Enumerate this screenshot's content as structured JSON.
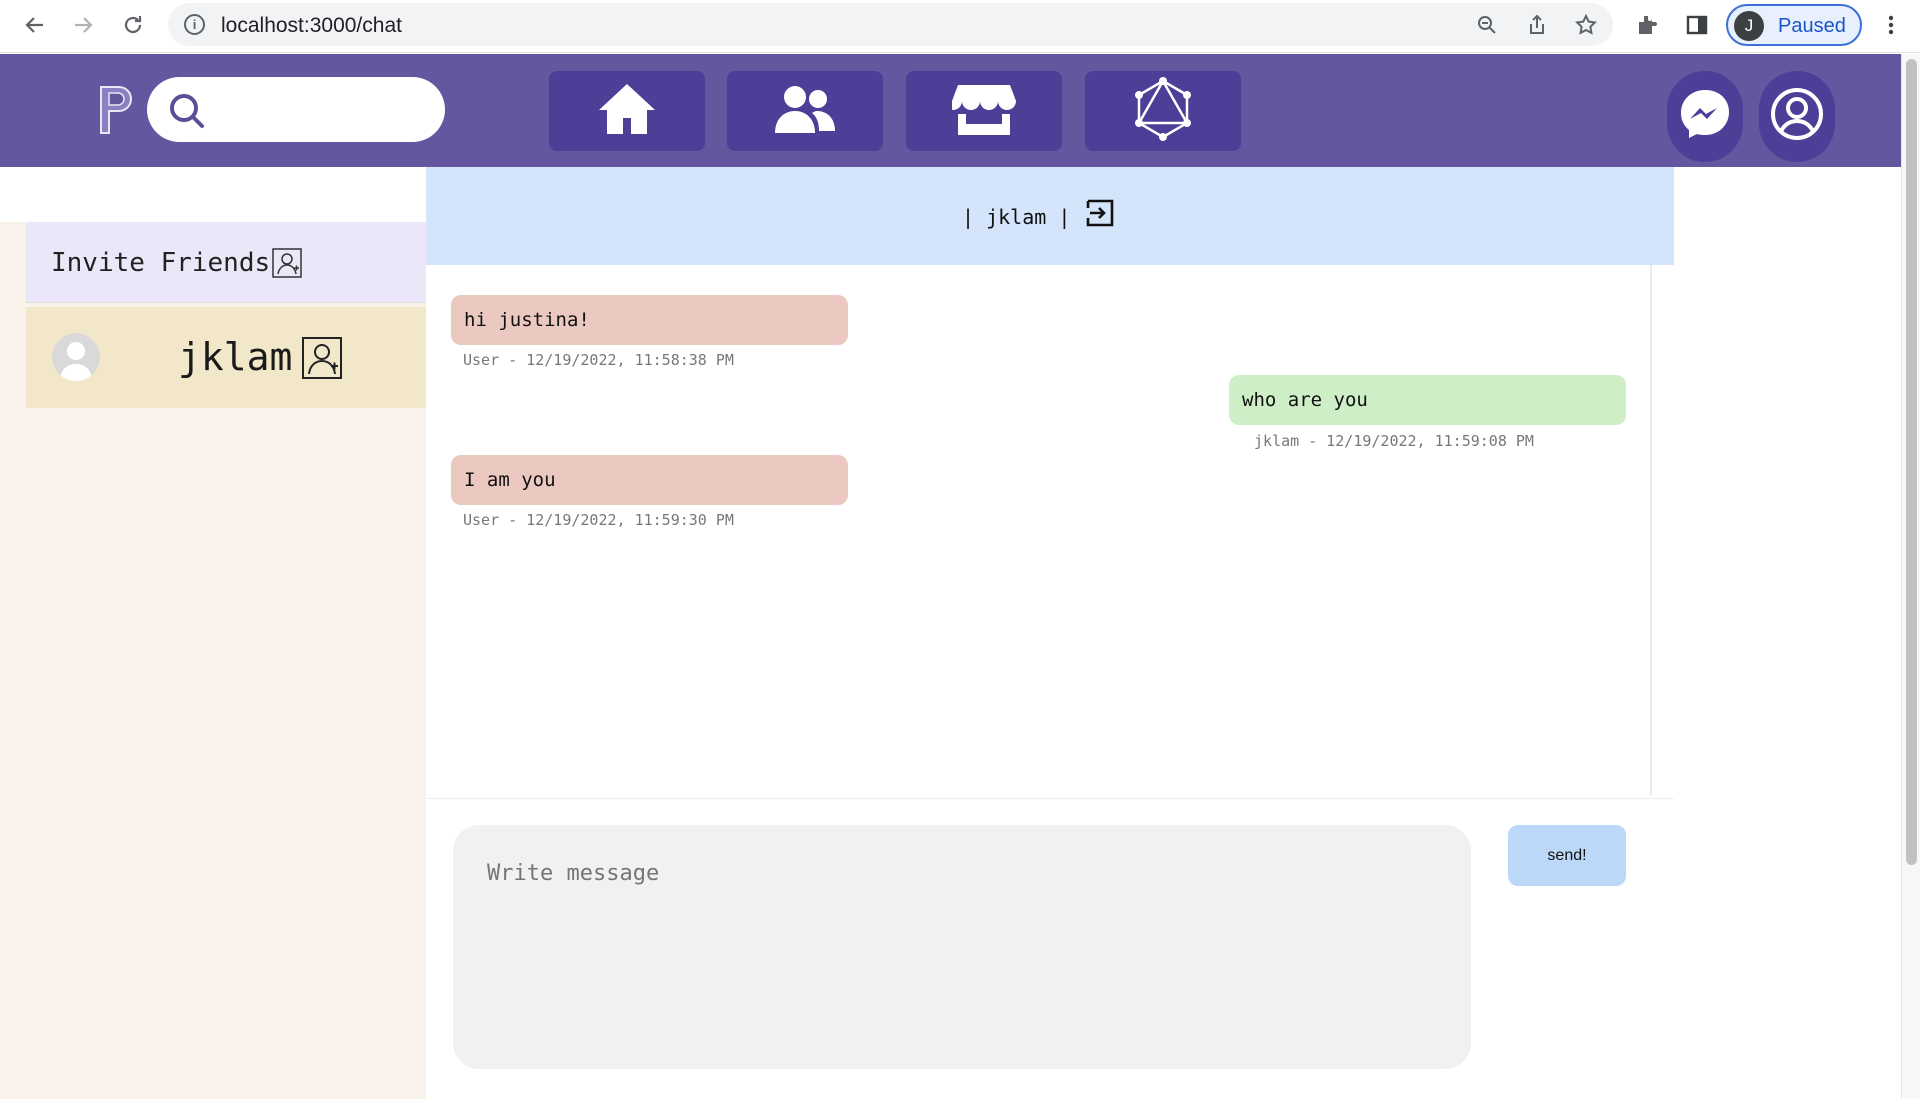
{
  "browser": {
    "url": "localhost:3000/chat",
    "profile_initial": "J",
    "profile_status": "Paused",
    "icons": [
      "back-icon",
      "forward-icon",
      "reload-icon",
      "info-icon",
      "zoom-icon",
      "share-icon",
      "star-icon",
      "extensions-icon",
      "sidebar-icon",
      "more-icon"
    ]
  },
  "header": {
    "search_placeholder": "",
    "nav": [
      "home-icon",
      "friends-icon",
      "store-icon",
      "graphql-icon"
    ],
    "right": [
      "messenger-icon",
      "account-icon"
    ],
    "colors": {
      "bar": "#6556a0",
      "tile": "#4b3f97"
    }
  },
  "sidebar": {
    "invite_label": "Invite Friends",
    "friends": [
      {
        "name": "jklam"
      }
    ]
  },
  "chat": {
    "title": "| jklam |",
    "messages": [
      {
        "side": "left",
        "text": "hi justina!",
        "meta": "User - 12/19/2022, 11:58:38 PM"
      },
      {
        "side": "right",
        "text": "who are you",
        "meta": "jklam - 12/19/2022, 11:59:08 PM"
      },
      {
        "side": "left",
        "text": "I am you",
        "meta": "User - 12/19/2022, 11:59:30 PM"
      }
    ],
    "input_placeholder": "Write message",
    "send_label": "send!",
    "colors": {
      "incoming": "#ebc9c1",
      "outgoing": "#cdeec7",
      "header": "#d4e4fb",
      "send": "#bcd8f8"
    }
  }
}
